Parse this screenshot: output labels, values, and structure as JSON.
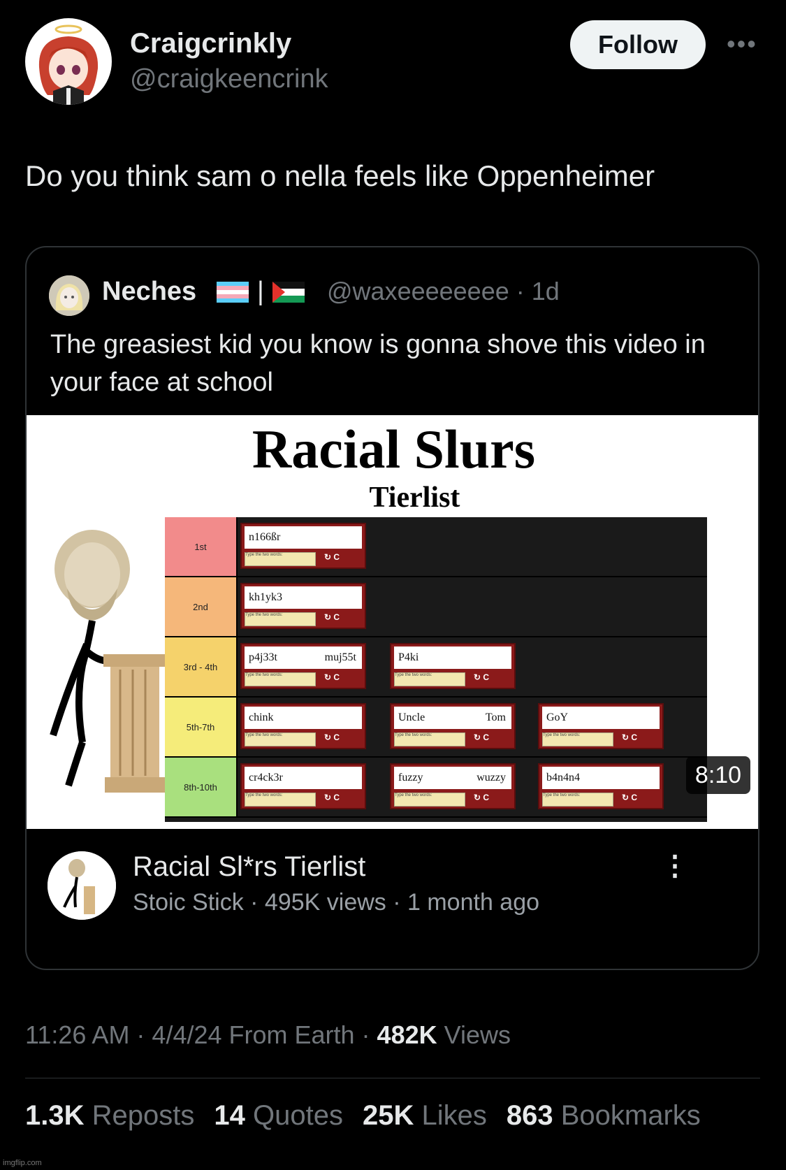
{
  "author": {
    "display_name": "Craigcrinkly",
    "handle": "@craigkeencrink"
  },
  "follow_label": "Follow",
  "more_label": "•••",
  "tweet_text": "Do you think sam o nella feels like Oppenheimer",
  "quote": {
    "name": "Neches",
    "separator": "|",
    "handle_time": "@waxeeeeeeee · 1d",
    "text": "The greasiest kid you know is gonna shove this video in your face at school",
    "video": {
      "thumb_title": "Racial Slurs",
      "thumb_subtitle": "Tierlist",
      "tiers": [
        {
          "label": "1st",
          "color": "#f28b8b",
          "items": [
            {
              "w1": "n166ßr",
              "w2": ""
            }
          ]
        },
        {
          "label": "2nd",
          "color": "#f5b77a",
          "items": [
            {
              "w1": "kh1yk3",
              "w2": ""
            }
          ]
        },
        {
          "label": "3rd - 4th",
          "color": "#f5d26b",
          "items": [
            {
              "w1": "p4j33t",
              "w2": "muj55t"
            },
            {
              "w1": "P4ki",
              "w2": ""
            }
          ]
        },
        {
          "label": "5th-7th",
          "color": "#f5ec7a",
          "items": [
            {
              "w1": "chink",
              "w2": ""
            },
            {
              "w1": "Uncle",
              "w2": "Tom"
            },
            {
              "w1": "GoY",
              "w2": ""
            }
          ]
        },
        {
          "label": "8th-10th",
          "color": "#a9e07e",
          "items": [
            {
              "w1": "cr4ck3r",
              "w2": ""
            },
            {
              "w1": "fuzzy",
              "w2": "wuzzy"
            },
            {
              "w1": "b4n4n4",
              "w2": ""
            }
          ]
        }
      ],
      "captcha_input_placeholder": "Type the two words:",
      "captcha_logo": "CAPTCHA",
      "duration": "8:10",
      "title": "Racial Sl*rs Tierlist",
      "meta": "Stoic Stick · 495K views · 1 month ago",
      "menu_icon": "⋮"
    }
  },
  "timestamp": {
    "time_date_source": "11:26 AM · 4/4/24 From Earth · ",
    "views_count": "482K",
    "views_label": " Views"
  },
  "stats": [
    {
      "count": "1.3K",
      "label": "Reposts"
    },
    {
      "count": "14",
      "label": "Quotes"
    },
    {
      "count": "25K",
      "label": "Likes"
    },
    {
      "count": "863",
      "label": "Bookmarks"
    }
  ],
  "watermark": "imgflip.com",
  "colors": {
    "background": "#000000",
    "text_primary": "#e7e9ea",
    "text_secondary": "#71767b",
    "follow_button": "#eff3f4",
    "border": "#2f3336"
  }
}
